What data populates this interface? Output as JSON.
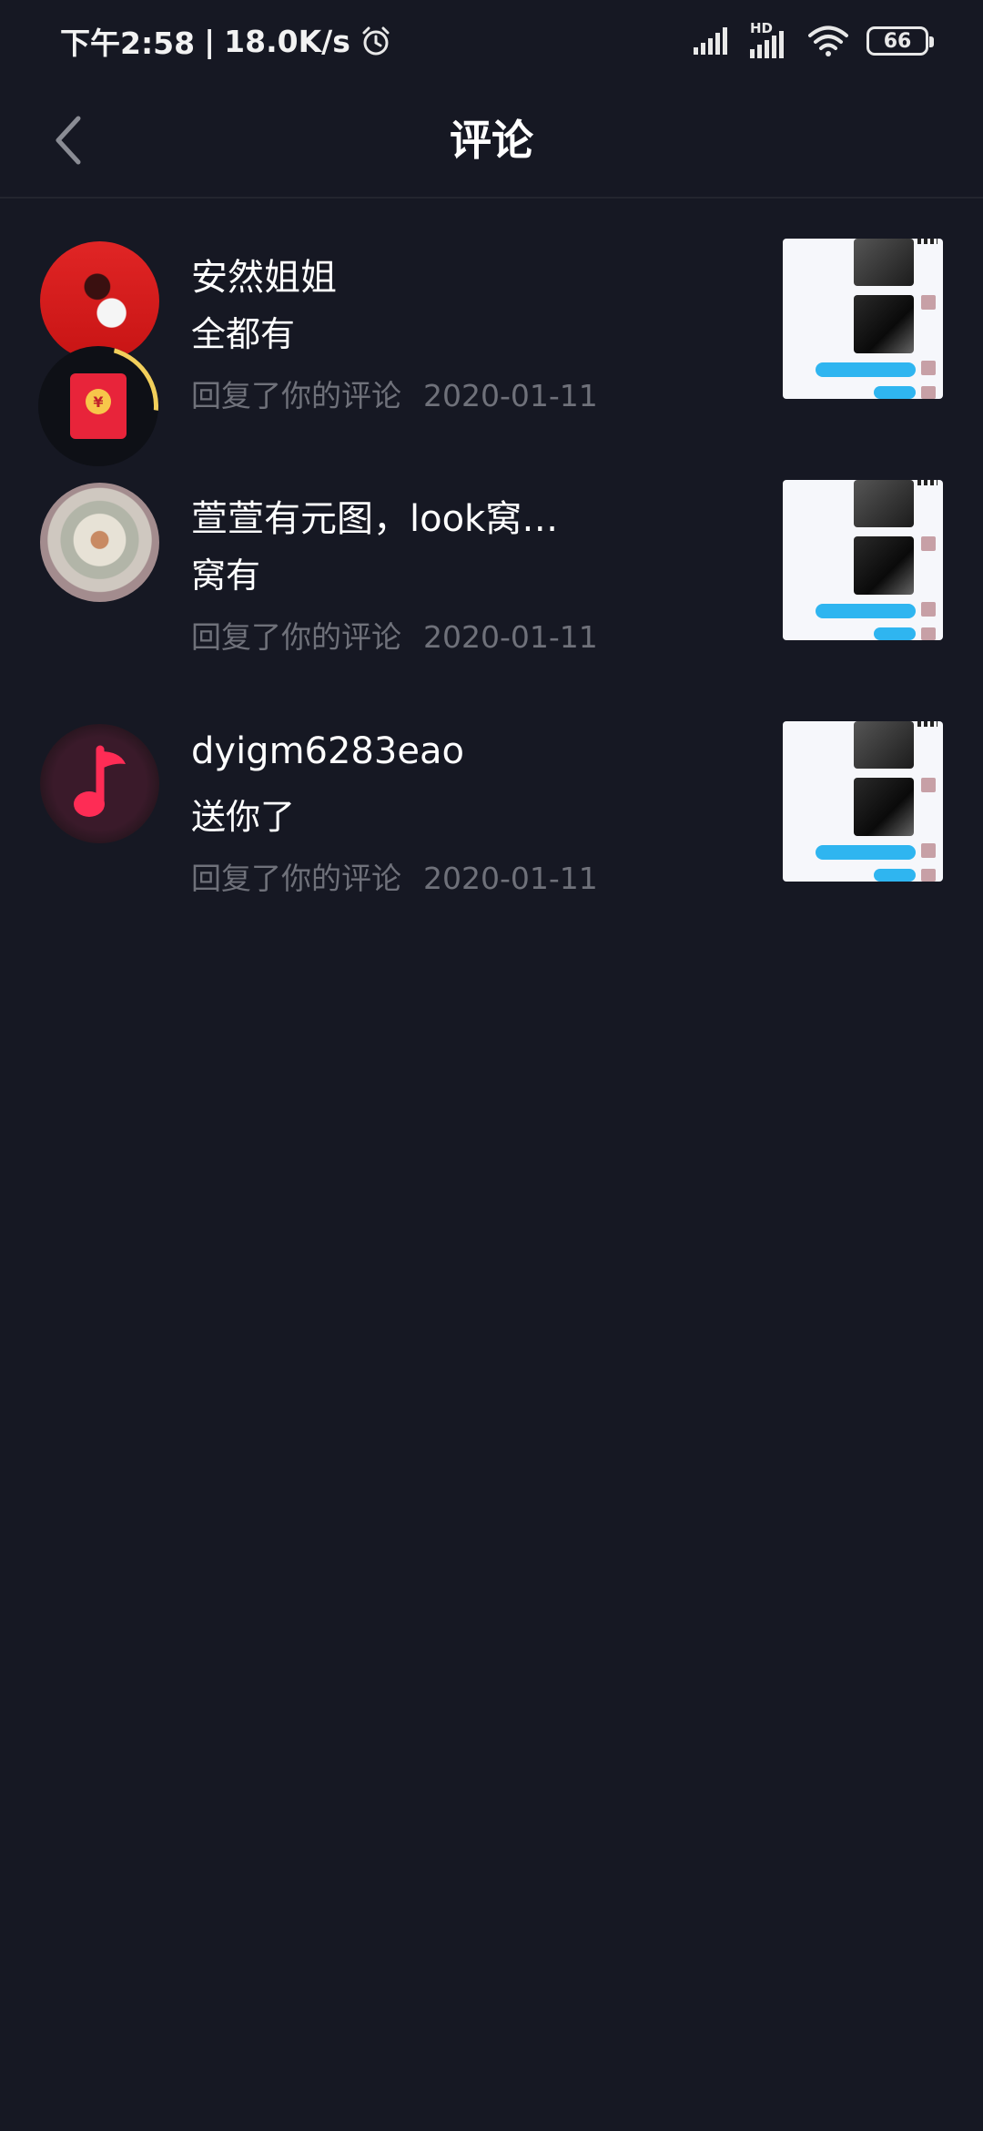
{
  "status_bar": {
    "time": "下午2:58",
    "network_speed": "18.0K/s",
    "alarm_icon": "alarm-icon",
    "signal_icon": "cell-signal-icon",
    "hd_label": "HD",
    "wifi_icon": "wifi-icon",
    "battery": "66"
  },
  "header": {
    "title": "评论",
    "back_icon": "chevron-left-icon"
  },
  "colors": {
    "background": "#161823",
    "meta_text": "#6f717a",
    "divider": "#23252f"
  },
  "comments": [
    {
      "name": "安然姐姐",
      "text": "全都有",
      "action": "回复了你的评论",
      "date": "2020-01-11",
      "badge": "red-packet-icon"
    },
    {
      "name": "萱萱有元图，look窝…",
      "text": "窝有",
      "action": "回复了你的评论",
      "date": "2020-01-11"
    },
    {
      "name": "dyigm6283eao",
      "text": "送你了",
      "action": "回复了你的评论",
      "date": "2020-01-11",
      "avatar_icon": "music-note-icon"
    }
  ]
}
